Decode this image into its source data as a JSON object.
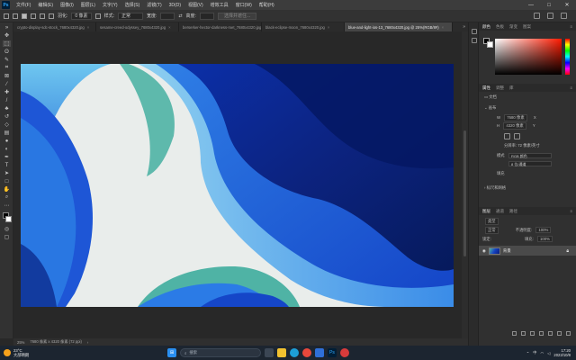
{
  "menubar": {
    "logo": "Ps",
    "items": [
      "文件(F)",
      "编辑(E)",
      "图像(I)",
      "图层(L)",
      "文字(Y)",
      "选择(S)",
      "滤镜(T)",
      "3D(D)",
      "视图(V)",
      "增效工具",
      "窗口(W)",
      "帮助(H)"
    ],
    "controls": [
      "—",
      "□",
      "✕"
    ]
  },
  "options": {
    "feather_label": "羽化:",
    "feather_value": "0 像素",
    "style_label": "样式:",
    "style_value": "正常",
    "width_label": "宽度:",
    "height_label": "高度:",
    "select_mask_button": "选择并遮住..."
  },
  "tabs": [
    {
      "label": "crypto-display-sdc-stock_7680x4320.jpg",
      "active": false
    },
    {
      "label": "sesame-creed-odyssey_7680x4320.jpg",
      "active": false
    },
    {
      "label": "berserker-hector-darkness-met_7680x4320.jpg",
      "active": false
    },
    {
      "label": "black-eclipse-moon_7680x4320.jpg",
      "active": false
    },
    {
      "label": "blue-and-light-ios-13_7680x4320.jpg @ 25%(RGB/8#)",
      "active": true
    }
  ],
  "status": {
    "zoom": "25%",
    "doc_info": "7680 像素 x 4320 像素 (72 ppi)"
  },
  "right_panel": {
    "color_tabs": [
      "颜色",
      "色板",
      "渐变",
      "图案"
    ],
    "props_tabs": [
      "属性",
      "调整",
      "库"
    ],
    "doc_label": "文档",
    "canvas_section": "画布",
    "width_label": "W",
    "width_value": "7680 像素",
    "height_label": "H",
    "height_value": "4320 像素",
    "x_label": "X",
    "y_label": "Y",
    "resolution": "分辨率: 72 像素/英寸",
    "mode_label": "模式",
    "mode_value": "RGB 颜色",
    "depth_value": "8 位/通道",
    "fill_label": "填充",
    "rulers_section": "标尺和网格",
    "layers_tabs": [
      "图层",
      "通道",
      "路径"
    ],
    "kind_label": "类型",
    "blend_mode": "正常",
    "opacity_label": "不透明度:",
    "opacity_value": "100%",
    "lock_label": "锁定:",
    "fill_opacity_label": "填充:",
    "fill_opacity_value": "100%",
    "layer_name": "背景"
  },
  "taskbar": {
    "temperature": "23°C",
    "weather_text": "大部晴朗",
    "search_placeholder": "搜索",
    "lang": "中",
    "time": "17:20",
    "date": "2023/10/8"
  },
  "colors": {
    "accent_blue": "#1e4fd8",
    "ps_blue": "#31a8ff",
    "doc_light": "#e8eceb",
    "teal": "#4fb3a5"
  }
}
